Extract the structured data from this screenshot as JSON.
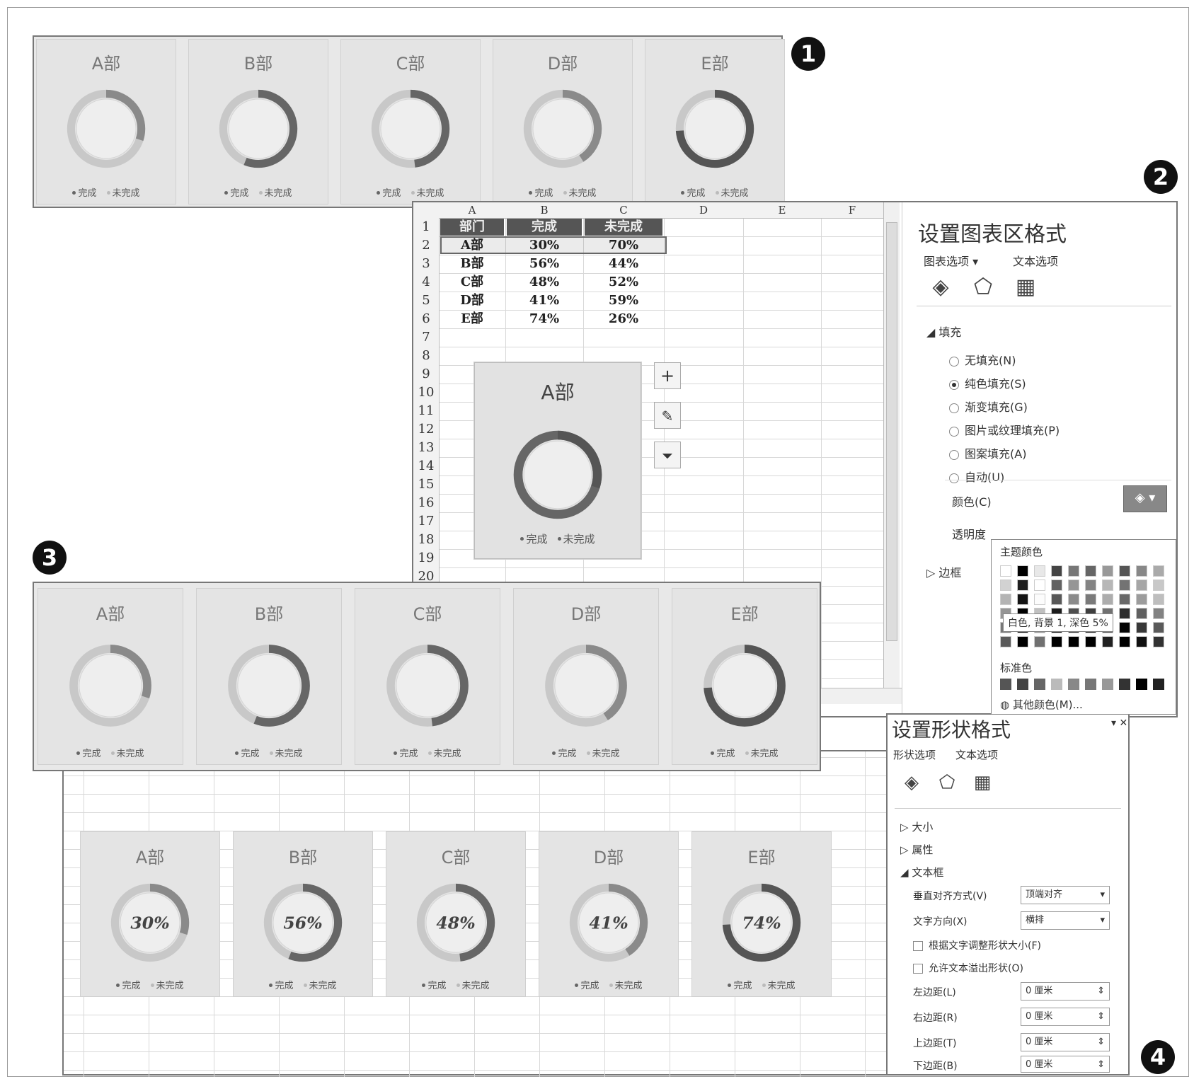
{
  "markers": [
    "1",
    "2",
    "3",
    "4"
  ],
  "legend": {
    "done": "完成",
    "undone": "未完成"
  },
  "departments": [
    {
      "name": "A部",
      "done": 0.3,
      "label": "30%"
    },
    {
      "name": "B部",
      "done": 0.56,
      "label": "56%"
    },
    {
      "name": "C部",
      "done": 0.48,
      "label": "48%"
    },
    {
      "name": "D部",
      "done": 0.41,
      "label": "41%"
    },
    {
      "name": "E部",
      "done": 0.74,
      "label": "74%"
    }
  ],
  "sheet": {
    "columns": [
      "A",
      "B",
      "C",
      "D",
      "E",
      "F"
    ],
    "rows": [
      "1",
      "2",
      "3",
      "4",
      "5",
      "6",
      "7",
      "8",
      "9",
      "10",
      "11",
      "12",
      "13",
      "14",
      "15",
      "16",
      "17",
      "18",
      "19",
      "20"
    ],
    "header": [
      "部门",
      "完成",
      "未完成"
    ],
    "data": [
      [
        "A部",
        "30%",
        "70%"
      ],
      [
        "B部",
        "56%",
        "44%"
      ],
      [
        "C部",
        "48%",
        "52%"
      ],
      [
        "D部",
        "41%",
        "59%"
      ],
      [
        "E部",
        "74%",
        "26%"
      ]
    ],
    "chart_title": "A部"
  },
  "format_chart_pane": {
    "title": "设置图表区格式",
    "tab_chart": "图表选项",
    "tab_text": "文本选项",
    "section_fill": "填充",
    "fill_options": [
      {
        "label": "无填充(N)",
        "selected": false
      },
      {
        "label": "纯色填充(S)",
        "selected": true
      },
      {
        "label": "渐变填充(G)",
        "selected": false
      },
      {
        "label": "图片或纹理填充(P)",
        "selected": false
      },
      {
        "label": "图案填充(A)",
        "selected": false
      },
      {
        "label": "自动(U)",
        "selected": false
      }
    ],
    "color_label": "颜色(C)",
    "transparency_label": "透明度",
    "section_border": "边框",
    "palette_title": "主题颜色",
    "palette_tooltip": "白色, 背景 1, 深色 5%",
    "standard_colors": "标准色",
    "more_colors": "其他颜色(M)..."
  },
  "format_shape_pane": {
    "title": "设置形状格式",
    "tab_shape": "形状选项",
    "tab_text": "文本选项",
    "size": "大小",
    "properties": "属性",
    "textbox": "文本框",
    "valign_label": "垂直对齐方式(V)",
    "valign_value": "顶端对齐",
    "direction_label": "文字方向(X)",
    "direction_value": "横排",
    "autofit_label": "根据文字调整形状大小(F)",
    "overflow_label": "允许文本溢出形状(O)",
    "margin_left_label": "左边距(L)",
    "margin_right_label": "右边距(R)",
    "margin_top_label": "上边距(T)",
    "margin_bottom_label": "下边距(B)",
    "margin_value": "0 厘米"
  },
  "colors": {
    "ring_dark": "#555555",
    "ring_mid": "#8a8a8a",
    "ring_light": "#c8c8c8",
    "panel": "#e6e6e6"
  }
}
